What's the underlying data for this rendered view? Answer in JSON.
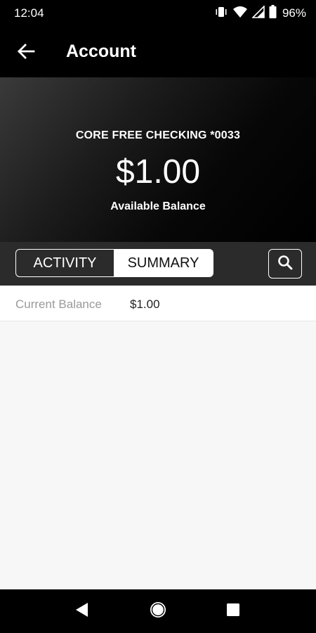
{
  "status_bar": {
    "time": "12:04",
    "battery": "96%",
    "icons": [
      "vibrate-icon",
      "wifi-icon",
      "signal-icon",
      "battery-icon"
    ]
  },
  "app_bar": {
    "title": "Account",
    "back_icon": "arrow-left-icon"
  },
  "account": {
    "name": "CORE FREE CHECKING *0033",
    "balance": "$1.00",
    "balance_label": "Available Balance"
  },
  "tabs": [
    {
      "label": "ACTIVITY",
      "selected": false
    },
    {
      "label": "SUMMARY",
      "selected": true
    }
  ],
  "search_icon": "search-icon",
  "summary": {
    "rows": [
      {
        "label": "Current Balance",
        "value": "$1.00"
      }
    ]
  },
  "nav": {
    "icons": [
      "back-triangle-icon",
      "home-circle-icon",
      "recents-square-icon"
    ]
  },
  "colors": {
    "header_bg": "#000000",
    "tab_strip_bg": "#2b2b2b",
    "content_bg": "#f7f7f7"
  }
}
